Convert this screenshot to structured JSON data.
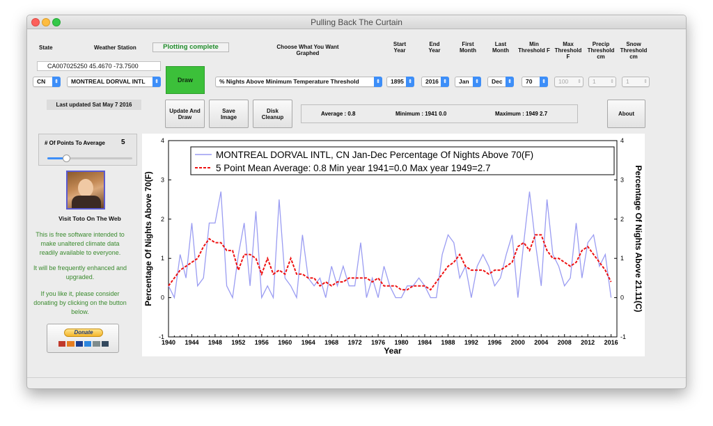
{
  "window": {
    "title": "Pulling Back The Curtain"
  },
  "headers": {
    "state": "State",
    "station": "Weather Station",
    "status": "Plotting complete",
    "choose": "Choose What You Want Graphed",
    "start_year": "Start Year",
    "end_year": "End Year",
    "first_month": "First Month",
    "last_month": "Last Month",
    "min_thresh": "Min Threshold F",
    "max_thresh": "Max Threshold F",
    "precip_thresh": "Precip Threshold cm",
    "snow_thresh": "Snow Threshold cm"
  },
  "station_info": "CA007025250  45.4670  -73.7500",
  "controls": {
    "state": "CN",
    "station": "MONTREAL DORVAL INTL",
    "measure": "% Nights Above Minimum Temperature Threshold",
    "start_year": "1895",
    "end_year": "2016",
    "first_month": "Jan",
    "last_month": "Dec",
    "min_threshold": "70",
    "max_threshold": "100",
    "precip_threshold": "1",
    "snow_threshold": "1"
  },
  "buttons": {
    "draw": "Draw",
    "update": "Update And Draw",
    "save": "Save Image",
    "cleanup": "Disk Cleanup",
    "about": "About"
  },
  "last_updated": "Last updated Sat May 7 2016",
  "stats": {
    "average": "Average : 0.8",
    "minimum": "Minimum : 1941  0.0",
    "maximum": "Maximum : 1949  2.7"
  },
  "averaging": {
    "label": "# Of Points To Average",
    "value": "5",
    "slider_fraction": 0.25
  },
  "sidebar": {
    "visit_link": "Visit Toto On The Web",
    "paragraph1": "This is free software intended to make unaltered climate data readily available to everyone.",
    "paragraph2": "It will be frequently enhanced and upgraded.",
    "paragraph3": "If you like it, please consider donating by clicking on the button below.",
    "donate": "Donate"
  },
  "colors": {
    "accent": "#3d8ef8",
    "draw_button": "#3cc03a",
    "series_raw": "#9a9cf2",
    "series_mean": "#ee1111",
    "sidebar_text": "#3a8a2e"
  },
  "chart_data": {
    "type": "line",
    "legend": [
      "MONTREAL DORVAL INTL, CN  Jan-Dec  Percentage Of Nights Above 70(F)",
      "5 Point Mean  Average: 0.8  Min year 1941=0.0  Max year 1949=2.7"
    ],
    "legend_placement": "top",
    "xlabel": "Year",
    "ylabel_left": "Percentage Of Nights Above 70(F)",
    "ylabel_right": "Percentage Of Nights Above 21.11(C)",
    "xlim": [
      1940,
      2017
    ],
    "ylim": [
      -1,
      4
    ],
    "xticks": [
      "1940",
      "1944",
      "1948",
      "1952",
      "1956",
      "1960",
      "1964",
      "1968",
      "1972",
      "1976",
      "1980",
      "1984",
      "1988",
      "1992",
      "1996",
      "2000",
      "2004",
      "2008",
      "2012",
      "2016"
    ],
    "yticks": [
      "-1",
      "0",
      "1",
      "2",
      "3",
      "4"
    ],
    "x": [
      1940,
      1941,
      1942,
      1943,
      1944,
      1945,
      1946,
      1947,
      1948,
      1949,
      1950,
      1951,
      1952,
      1953,
      1954,
      1955,
      1956,
      1957,
      1958,
      1959,
      1960,
      1961,
      1962,
      1963,
      1964,
      1965,
      1966,
      1967,
      1968,
      1969,
      1970,
      1971,
      1972,
      1973,
      1974,
      1975,
      1976,
      1977,
      1978,
      1979,
      1980,
      1981,
      1982,
      1983,
      1984,
      1985,
      1986,
      1987,
      1988,
      1989,
      1990,
      1991,
      1992,
      1993,
      1994,
      1995,
      1996,
      1997,
      1998,
      1999,
      2000,
      2001,
      2002,
      2003,
      2004,
      2005,
      2006,
      2007,
      2008,
      2009,
      2010,
      2011,
      2012,
      2013,
      2014,
      2015,
      2016
    ],
    "series": [
      {
        "name": "MONTREAL DORVAL INTL, CN  Jan-Dec  Percentage Of Nights Above 70(F)",
        "color": "#9a9cf2",
        "values": [
          0.3,
          0.0,
          1.1,
          0.5,
          1.9,
          0.3,
          0.5,
          1.9,
          1.9,
          2.7,
          0.3,
          0.0,
          1.1,
          1.9,
          0.3,
          2.2,
          0.0,
          0.3,
          0.0,
          2.5,
          0.5,
          0.3,
          0.0,
          1.6,
          0.5,
          0.3,
          0.5,
          0.0,
          0.8,
          0.3,
          0.8,
          0.3,
          0.3,
          1.4,
          0.0,
          0.5,
          0.0,
          0.8,
          0.3,
          0.0,
          0.0,
          0.3,
          0.3,
          0.5,
          0.3,
          0.0,
          0.0,
          1.1,
          1.6,
          1.4,
          0.5,
          0.8,
          0.0,
          0.8,
          1.1,
          0.8,
          0.3,
          0.5,
          1.1,
          1.6,
          0.0,
          1.4,
          2.7,
          1.4,
          0.3,
          2.5,
          1.1,
          0.8,
          0.3,
          0.5,
          1.9,
          0.5,
          1.4,
          1.6,
          0.8,
          1.1,
          0.0
        ]
      },
      {
        "name": "5 Point Mean  Average: 0.8  Min year 1941=0.0  Max year 1949=2.7",
        "color": "#ee1111",
        "values": [
          0.3,
          0.5,
          0.7,
          0.8,
          0.9,
          1.0,
          1.3,
          1.5,
          1.4,
          1.4,
          1.2,
          1.2,
          0.7,
          1.1,
          1.1,
          1.0,
          0.6,
          1.0,
          0.6,
          0.7,
          0.6,
          1.0,
          0.6,
          0.6,
          0.5,
          0.5,
          0.3,
          0.4,
          0.3,
          0.4,
          0.4,
          0.5,
          0.5,
          0.5,
          0.5,
          0.4,
          0.5,
          0.3,
          0.3,
          0.3,
          0.2,
          0.2,
          0.3,
          0.3,
          0.3,
          0.2,
          0.4,
          0.6,
          0.8,
          0.9,
          1.1,
          0.8,
          0.7,
          0.7,
          0.7,
          0.6,
          0.7,
          0.7,
          0.8,
          0.9,
          1.3,
          1.4,
          1.2,
          1.6,
          1.6,
          1.2,
          1.0,
          1.0,
          0.9,
          0.8,
          0.9,
          1.2,
          1.3,
          1.1,
          0.9,
          0.7,
          0.4
        ]
      }
    ]
  }
}
